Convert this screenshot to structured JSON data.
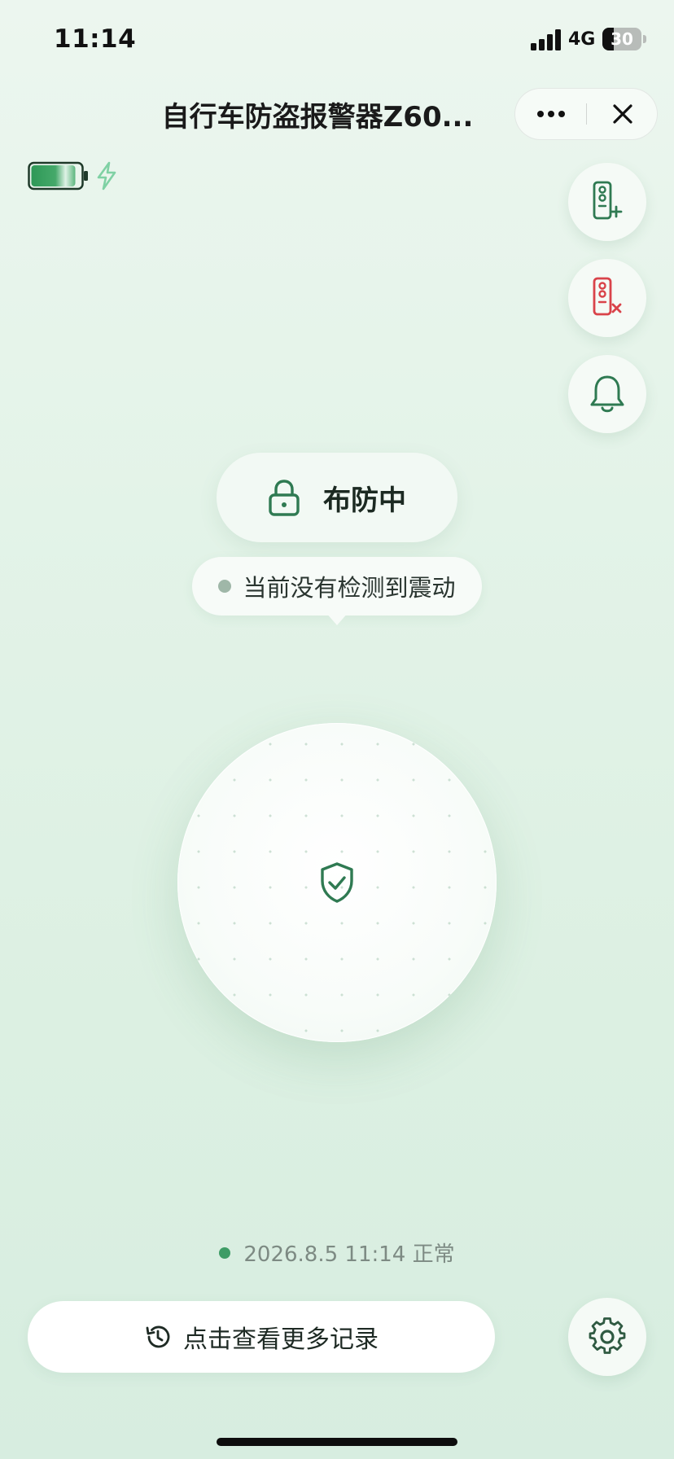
{
  "status_bar": {
    "time": "11:14",
    "network": "4G",
    "battery_level": "30",
    "battery_fraction": 0.3
  },
  "nav": {
    "title": "自行车防盗报警器Z60...",
    "more_icon": "more-dots-icon",
    "close_icon": "close-icon"
  },
  "device": {
    "battery_fraction": 0.9,
    "charging": true,
    "colors": {
      "battery_fill": "#2f9a5a",
      "charging": "#7fd1a4"
    }
  },
  "actions": {
    "add_remote_icon": "remote-add-icon",
    "remove_remote_icon": "remote-remove-icon",
    "alarm_icon": "bell-icon",
    "settings_icon": "gear-icon"
  },
  "arm_status": {
    "label": "布防中",
    "icon": "lock-icon"
  },
  "vibration": {
    "text": "当前没有检测到震动"
  },
  "center": {
    "icon": "shield-check-icon"
  },
  "last_update": {
    "text": "2026.8.5 11:14 正常"
  },
  "records": {
    "label": "点击查看更多记录",
    "icon": "history-icon"
  },
  "colors": {
    "accent": "#2f7a52",
    "danger": "#d9434a",
    "background": "#e3f3e8"
  }
}
